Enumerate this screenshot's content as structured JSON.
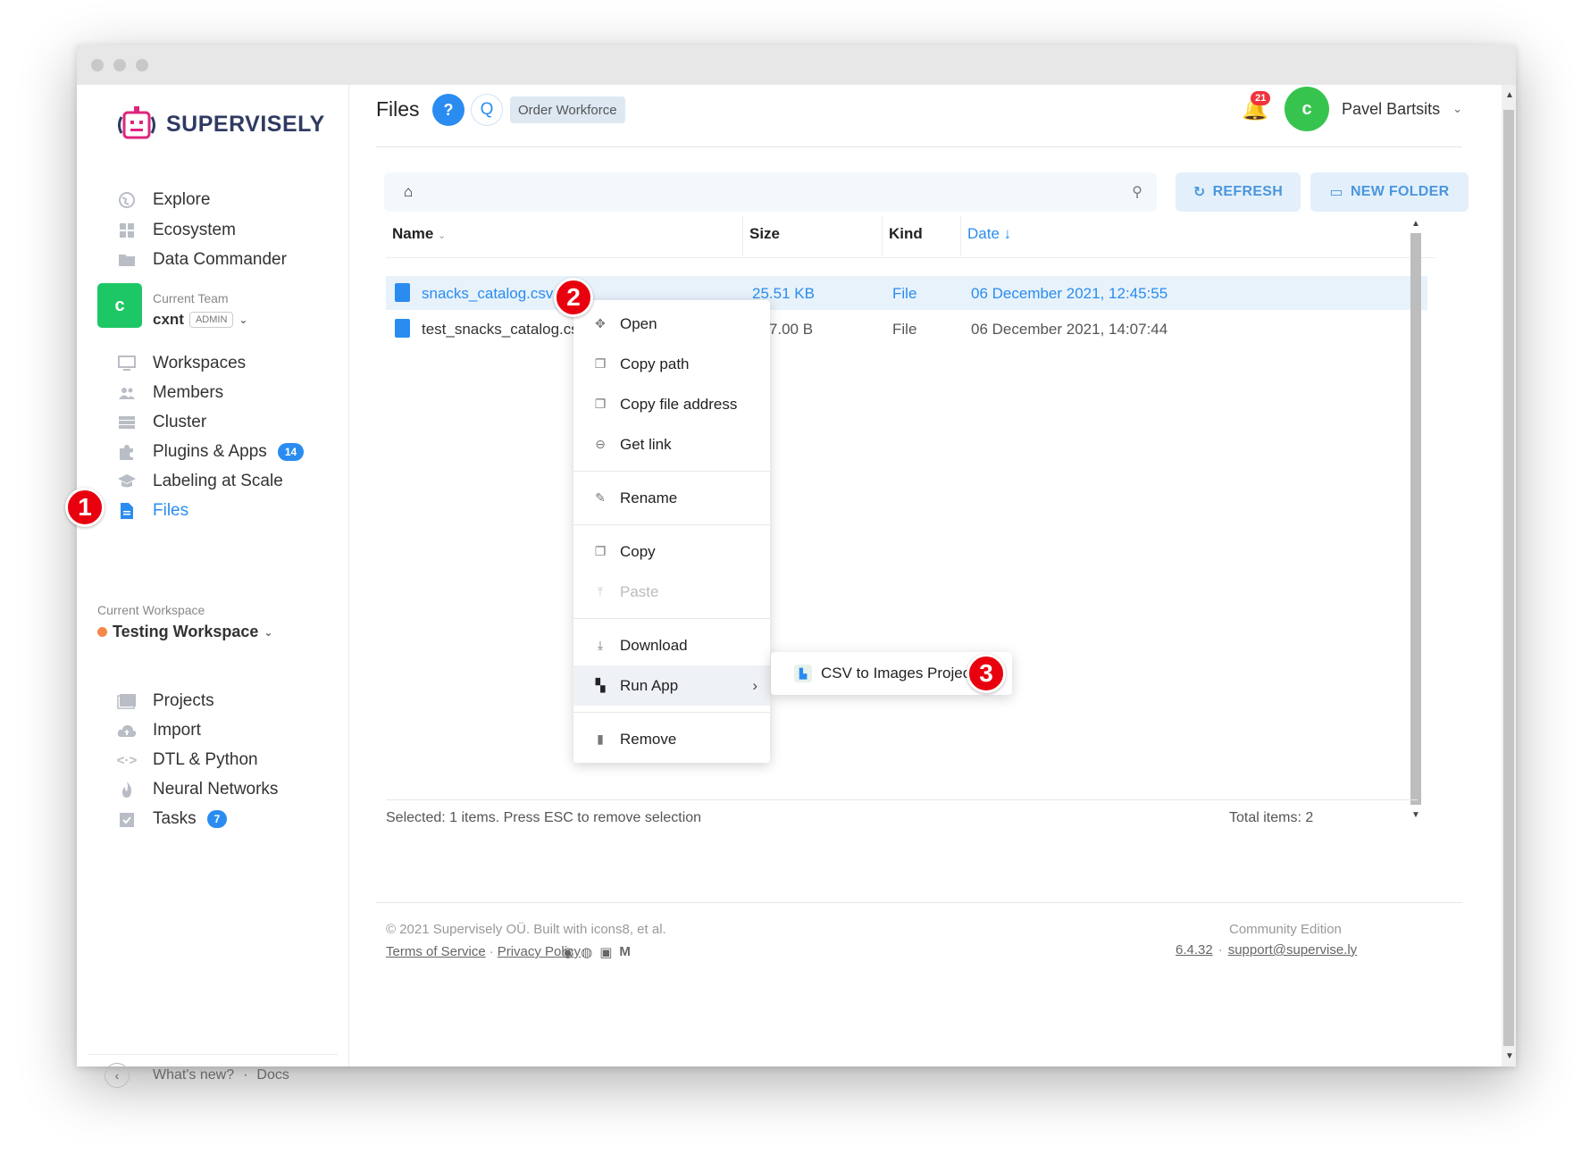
{
  "app": {
    "brand": "SUPERVISELY"
  },
  "sidebar": {
    "top_items": [
      {
        "label": "Explore",
        "icon": "globe-icon"
      },
      {
        "label": "Ecosystem",
        "icon": "grid-icon"
      },
      {
        "label": "Data Commander",
        "icon": "folder-icon"
      }
    ],
    "team": {
      "avatar_letter": "c",
      "caption": "Current Team",
      "name": "cxnt",
      "role": "ADMIN"
    },
    "team_items": [
      {
        "label": "Workspaces",
        "icon": "monitor-icon"
      },
      {
        "label": "Members",
        "icon": "users-icon"
      },
      {
        "label": "Cluster",
        "icon": "server-icon"
      },
      {
        "label": "Plugins & Apps",
        "icon": "puzzle-icon",
        "badge": "14"
      },
      {
        "label": "Labeling at Scale",
        "icon": "graduation-icon"
      },
      {
        "label": "Files",
        "icon": "file-icon",
        "active": true
      }
    ],
    "workspace": {
      "caption": "Current Workspace",
      "name": "Testing Workspace"
    },
    "workspace_items": [
      {
        "label": "Projects",
        "icon": "images-icon"
      },
      {
        "label": "Import",
        "icon": "cloud-upload-icon"
      },
      {
        "label": "DTL & Python",
        "icon": "code-icon"
      },
      {
        "label": "Neural Networks",
        "icon": "flame-icon"
      },
      {
        "label": "Tasks",
        "icon": "clipboard-icon",
        "badge": "7"
      }
    ],
    "footer": {
      "whats_new": "What's new?",
      "separator": "·",
      "docs": "Docs"
    }
  },
  "header": {
    "title": "Files",
    "help_label": "?",
    "q_label": "Q",
    "order_label": "Order Workforce",
    "notifications_count": "21",
    "user_initial": "c",
    "user_name": "Pavel Bartsits"
  },
  "toolbar": {
    "refresh_label": "REFRESH",
    "new_folder_label": "NEW FOLDER"
  },
  "table": {
    "columns": {
      "name": "Name",
      "size": "Size",
      "kind": "Kind",
      "date": "Date ↓"
    },
    "rows": [
      {
        "name": "snacks_catalog.csv",
        "size": "25.51 KB",
        "kind": "File",
        "date": "06 December 2021, 12:45:55",
        "selected": true
      },
      {
        "name": "test_snacks_catalog.csv",
        "size": "267.00 B",
        "kind": "File",
        "date": "06 December 2021, 14:07:44",
        "selected": false
      }
    ],
    "selection_text": "Selected: 1 items. Press ESC to remove selection",
    "total_text": "Total items: 2"
  },
  "context_menu": {
    "open": "Open",
    "copy_path": "Copy path",
    "copy_file_address": "Copy file address",
    "get_link": "Get link",
    "rename": "Rename",
    "copy": "Copy",
    "paste": "Paste",
    "download": "Download",
    "run_app": "Run App",
    "remove": "Remove",
    "submenu_app": "CSV to Images Project"
  },
  "markers": [
    "1",
    "2",
    "3"
  ],
  "footer": {
    "copyright": "© 2021 Supervisely OÜ. Built with icons8, et al.",
    "terms": "Terms of Service",
    "dot": "·",
    "privacy": "Privacy Policy",
    "edition": "Community Edition",
    "version": "6.4.32",
    "support": "support@supervise.ly"
  },
  "colors": {
    "accent": "#2a8cf0",
    "marker": "#e8000e",
    "team_green": "#1ec766"
  }
}
